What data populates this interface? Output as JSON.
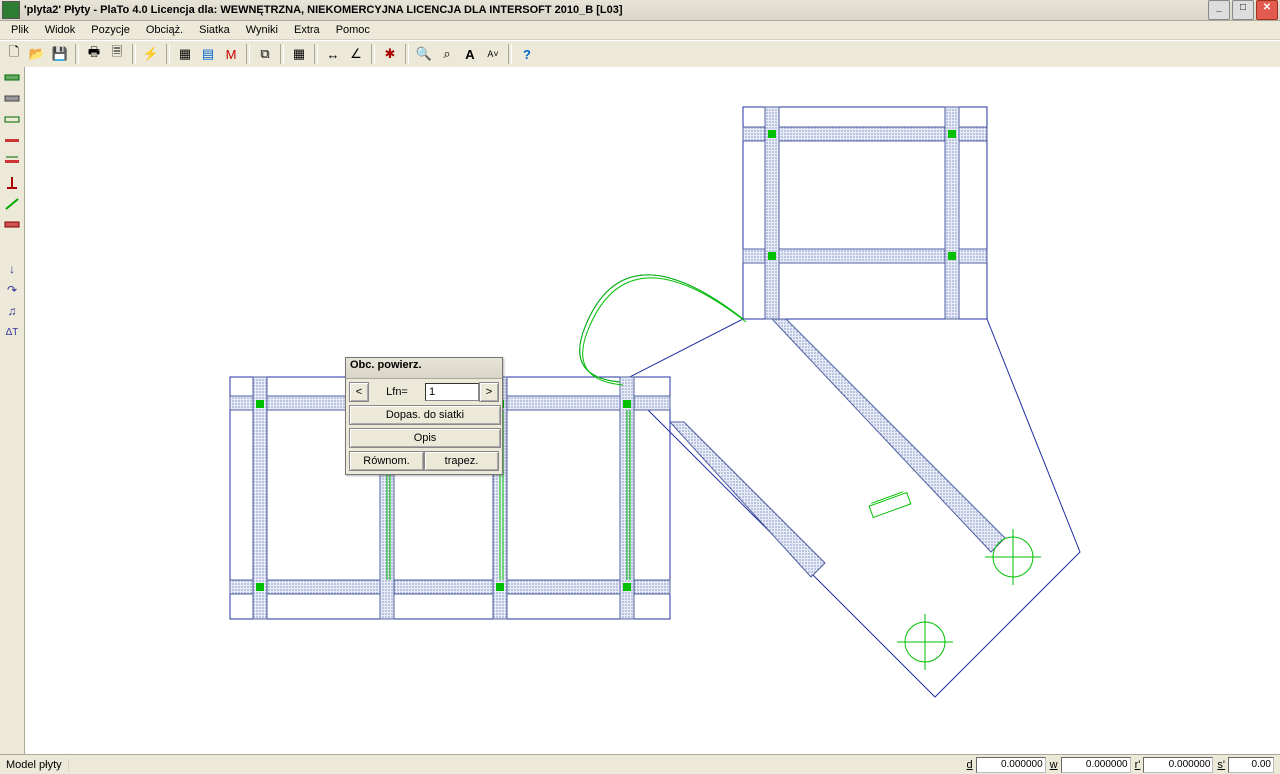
{
  "title": "'plyta2' Płyty   - PlaTo 4.0  Licencja dla: WEWNĘTRZNA, NIEKOMERCYJNA LICENCJA DLA INTERSOFT 2010_B [L03]",
  "menu": {
    "plik": "Plik",
    "widok": "Widok",
    "pozycje": "Pozycje",
    "obciaz": "Obciąż.",
    "siatka": "Siatka",
    "wyniki": "Wyniki",
    "extra": "Extra",
    "pomoc": "Pomoc"
  },
  "dialog": {
    "title": "Obc. powierz.",
    "lfn_label": "Lfn=",
    "lfn_value": "1",
    "btn_fit": "Dopas. do siatki",
    "btn_desc": "Opis",
    "btn_uniform": "Równom.",
    "btn_trapez": "trapez."
  },
  "status": {
    "msg": "Model płyty",
    "d_label": "d",
    "d_val": "0.000000",
    "w_label": "w",
    "w_val": "0.000000",
    "r_label": "r'",
    "r_val": "0.000000",
    "s_label": "s'",
    "s_val": "0.00"
  },
  "toolbar_icons": [
    "new-file-icon",
    "open-file-icon",
    "save-icon",
    "print-icon",
    "print-preview-icon",
    "bolt-icon",
    "grid-icon",
    "layers-icon",
    "m-icon",
    "copy-icon",
    "grid2-icon",
    "measure-icon",
    "angle-icon",
    "bug-icon",
    "zoom-in-icon",
    "zoom-area-icon",
    "text-a-icon",
    "text-small-icon",
    "help-icon"
  ],
  "sidebar_icons": [
    "slab-green-icon",
    "slab-grey-icon",
    "slab-outline-icon",
    "bar-red-icon",
    "bar-red2-icon",
    "support-icon",
    "draw-green-icon",
    "slab-red-icon",
    "arrow-down-icon",
    "arrow-curve-icon",
    "note-icon",
    "delta-t-icon"
  ]
}
